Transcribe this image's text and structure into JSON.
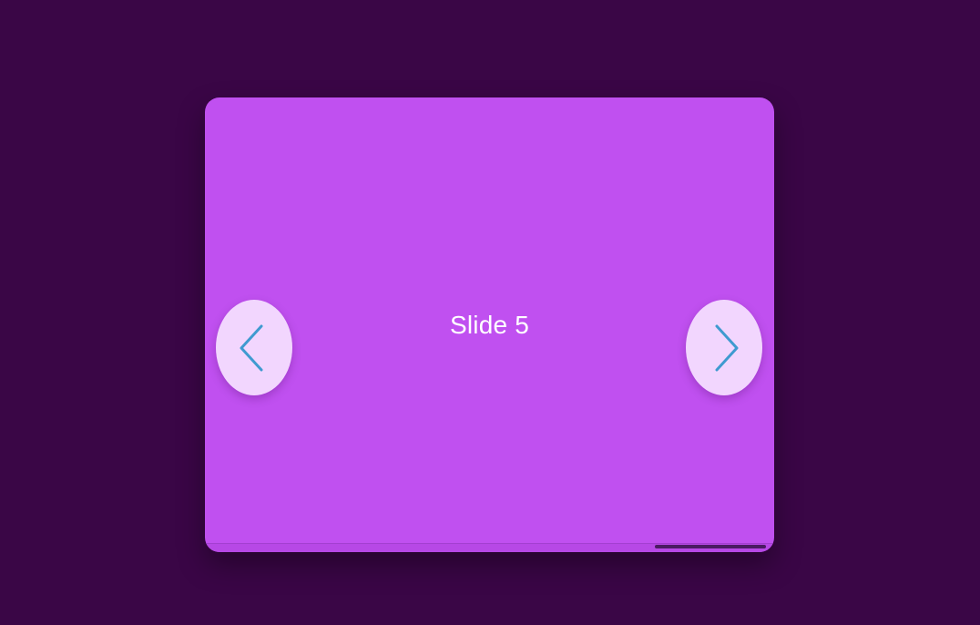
{
  "carousel": {
    "slide_label": "Slide 5",
    "current_slide": 5,
    "total_slides": 5,
    "progress_fraction": 1.0,
    "prev_icon": "chevron-left-icon",
    "next_icon": "chevron-right-icon"
  },
  "colors": {
    "page_background": "#3a0646",
    "slide_background": "#c050f0",
    "nav_button_background": "#f5e1ff",
    "chevron": "#3f9ad0",
    "progress_fill": "#4b1a63"
  }
}
